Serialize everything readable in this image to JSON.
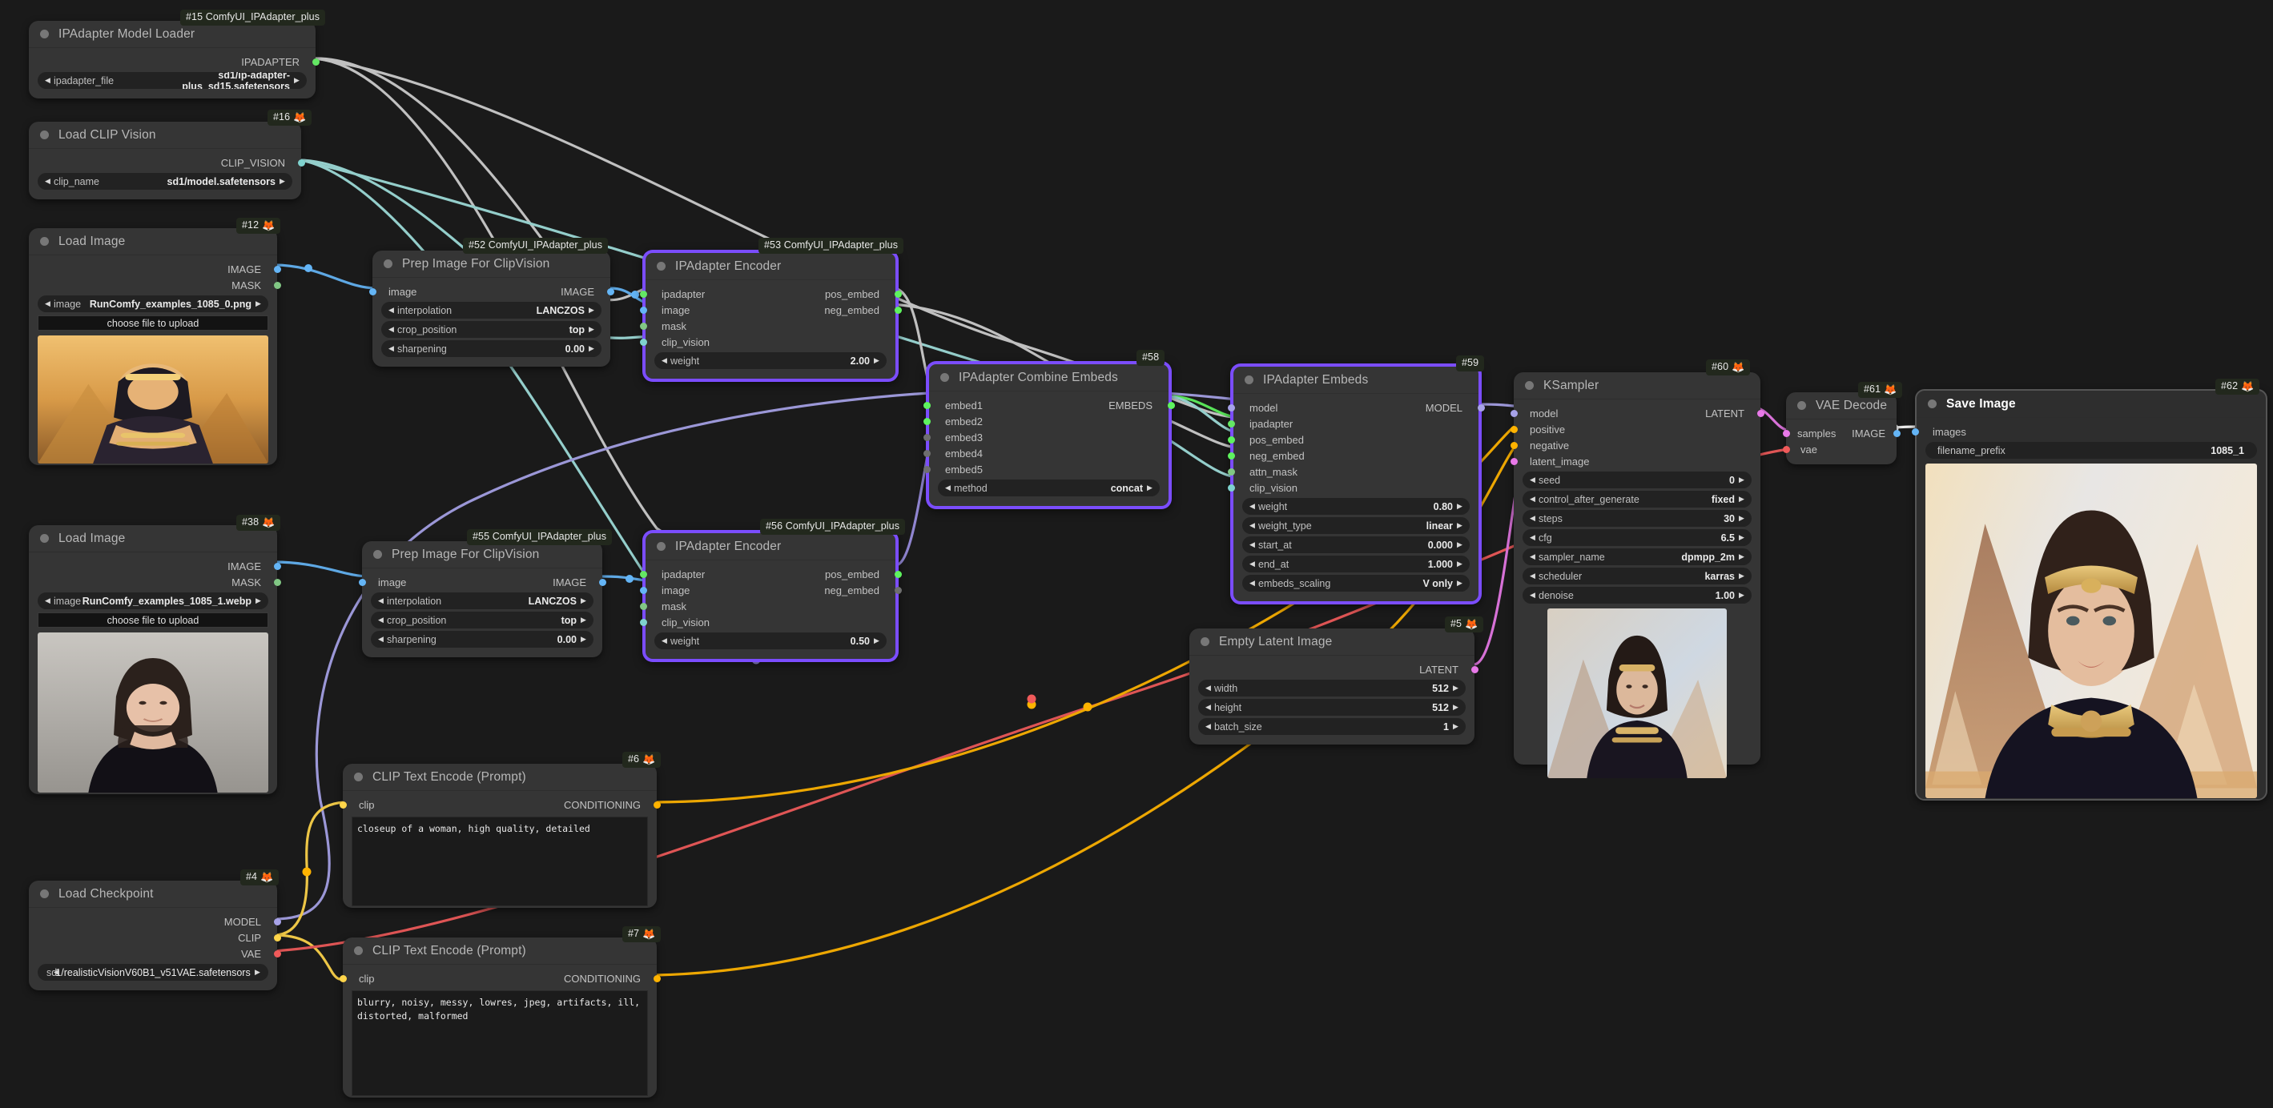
{
  "app": {
    "name": "ComfyUI",
    "canvas_background": "#1a1a1a"
  },
  "colors": {
    "selected_node_border": "#7b4dff",
    "node_body": "#353535",
    "badge_background": "#22281d",
    "image_link": "#64b5f6",
    "clipvision_link": "#7fd3cf",
    "ipadapter_link": "#64e764",
    "model_link": "#a7a2e8",
    "conditioning_link": "#ffb300",
    "vae_link": "#f05a5a",
    "latent_link": "#e879e8"
  },
  "nodes": {
    "ipadapter_model_loader": {
      "badge": "#15 ComfyUI_IPAdapter_plus",
      "badge_icon": "",
      "title": "IPAdapter Model Loader",
      "outputs": [
        {
          "label": "IPADAPTER",
          "type": "IPADAPTER"
        }
      ],
      "widgets": [
        {
          "label": "ipadapter_file",
          "value": "sd1/ip-adapter-plus_sd15.safetensors"
        }
      ]
    },
    "load_clip_vision": {
      "badge": "#16",
      "badge_icon": "🦊",
      "title": "Load CLIP Vision",
      "outputs": [
        {
          "label": "CLIP_VISION",
          "type": "CLIPVISION"
        }
      ],
      "widgets": [
        {
          "label": "clip_name",
          "value": "sd1/model.safetensors"
        }
      ]
    },
    "load_image_1": {
      "badge": "#12",
      "badge_icon": "🦊",
      "title": "Load Image",
      "outputs": [
        {
          "label": "IMAGE",
          "type": "IMAGE"
        },
        {
          "label": "MASK",
          "type": "MASK"
        }
      ],
      "widgets": [
        {
          "label": "image",
          "value": "RunComfy_examples_1085_0.png"
        }
      ],
      "upload_button": "choose file to upload"
    },
    "load_image_2": {
      "badge": "#38",
      "badge_icon": "🦊",
      "title": "Load Image",
      "outputs": [
        {
          "label": "IMAGE",
          "type": "IMAGE"
        },
        {
          "label": "MASK",
          "type": "MASK"
        }
      ],
      "widgets": [
        {
          "label": "image",
          "value": "RunComfy_examples_1085_1.webp"
        }
      ],
      "upload_button": "choose file to upload"
    },
    "prep_image_1": {
      "badge": "#52 ComfyUI_IPAdapter_plus",
      "badge_icon": "",
      "title": "Prep Image For ClipVision",
      "inputs": [
        {
          "label": "image",
          "type": "IMAGE"
        }
      ],
      "outputs": [
        {
          "label": "IMAGE",
          "type": "IMAGE"
        }
      ],
      "widgets": [
        {
          "label": "interpolation",
          "value": "LANCZOS"
        },
        {
          "label": "crop_position",
          "value": "top"
        },
        {
          "label": "sharpening",
          "value": "0.00"
        }
      ]
    },
    "prep_image_2": {
      "badge": "#55 ComfyUI_IPAdapter_plus",
      "badge_icon": "",
      "title": "Prep Image For ClipVision",
      "inputs": [
        {
          "label": "image",
          "type": "IMAGE"
        }
      ],
      "outputs": [
        {
          "label": "IMAGE",
          "type": "IMAGE"
        }
      ],
      "widgets": [
        {
          "label": "interpolation",
          "value": "LANCZOS"
        },
        {
          "label": "crop_position",
          "value": "top"
        },
        {
          "label": "sharpening",
          "value": "0.00"
        }
      ]
    },
    "ipadapter_encoder_1": {
      "badge": "#53 ComfyUI_IPAdapter_plus",
      "badge_icon": "",
      "title": "IPAdapter Encoder",
      "selected": true,
      "inputs": [
        {
          "label": "ipadapter",
          "type": "IPADAPTER"
        },
        {
          "label": "image",
          "type": "IMAGE"
        },
        {
          "label": "mask",
          "type": "MASK"
        },
        {
          "label": "clip_vision",
          "type": "CLIPVISION"
        }
      ],
      "outputs": [
        {
          "label": "pos_embed",
          "type": "EMBEDS"
        },
        {
          "label": "neg_embed",
          "type": "EMBEDS"
        }
      ],
      "widgets": [
        {
          "label": "weight",
          "value": "2.00"
        }
      ]
    },
    "ipadapter_encoder_2": {
      "badge": "#56 ComfyUI_IPAdapter_plus",
      "badge_icon": "",
      "title": "IPAdapter Encoder",
      "selected": true,
      "inputs": [
        {
          "label": "ipadapter",
          "type": "IPADAPTER"
        },
        {
          "label": "image",
          "type": "IMAGE"
        },
        {
          "label": "mask",
          "type": "MASK"
        },
        {
          "label": "clip_vision",
          "type": "CLIPVISION"
        }
      ],
      "outputs": [
        {
          "label": "pos_embed",
          "type": "EMBEDS"
        },
        {
          "label": "neg_embed",
          "type": "off"
        }
      ],
      "widgets": [
        {
          "label": "weight",
          "value": "0.50"
        }
      ]
    },
    "combine_embeds": {
      "badge": "#58",
      "badge_icon": "",
      "title": "IPAdapter Combine Embeds",
      "selected": true,
      "inputs": [
        {
          "label": "embed1",
          "type": "EMBEDS"
        },
        {
          "label": "embed2",
          "type": "EMBEDS"
        },
        {
          "label": "embed3",
          "type": "off"
        },
        {
          "label": "embed4",
          "type": "off"
        },
        {
          "label": "embed5",
          "type": "off"
        }
      ],
      "outputs": [
        {
          "label": "EMBEDS",
          "type": "EMBEDS"
        }
      ],
      "widgets": [
        {
          "label": "method",
          "value": "concat"
        }
      ]
    },
    "ipadapter_embeds": {
      "badge": "#59",
      "badge_icon": "",
      "title": "IPAdapter Embeds",
      "selected": true,
      "inputs": [
        {
          "label": "model",
          "type": "MODEL"
        },
        {
          "label": "ipadapter",
          "type": "IPADAPTER"
        },
        {
          "label": "pos_embed",
          "type": "EMBEDS"
        },
        {
          "label": "neg_embed",
          "type": "EMBEDS"
        },
        {
          "label": "attn_mask",
          "type": "MASK"
        },
        {
          "label": "clip_vision",
          "type": "CLIPVISION"
        }
      ],
      "outputs": [
        {
          "label": "MODEL",
          "type": "MODEL"
        }
      ],
      "widgets": [
        {
          "label": "weight",
          "value": "0.80"
        },
        {
          "label": "weight_type",
          "value": "linear"
        },
        {
          "label": "start_at",
          "value": "0.000"
        },
        {
          "label": "end_at",
          "value": "1.000"
        },
        {
          "label": "embeds_scaling",
          "value": "V only"
        }
      ]
    },
    "ksampler": {
      "badge": "#60",
      "badge_icon": "🦊",
      "title": "KSampler",
      "inputs": [
        {
          "label": "model",
          "type": "MODEL"
        },
        {
          "label": "positive",
          "type": "COND"
        },
        {
          "label": "negative",
          "type": "COND"
        },
        {
          "label": "latent_image",
          "type": "LATENT"
        }
      ],
      "outputs": [
        {
          "label": "LATENT",
          "type": "LATENT"
        }
      ],
      "widgets": [
        {
          "label": "seed",
          "value": "0"
        },
        {
          "label": "control_after_generate",
          "value": "fixed"
        },
        {
          "label": "steps",
          "value": "30"
        },
        {
          "label": "cfg",
          "value": "6.5"
        },
        {
          "label": "sampler_name",
          "value": "dpmpp_2m"
        },
        {
          "label": "scheduler",
          "value": "karras"
        },
        {
          "label": "denoise",
          "value": "1.00"
        }
      ]
    },
    "empty_latent_image": {
      "badge": "#5",
      "badge_icon": "🦊",
      "title": "Empty Latent Image",
      "outputs": [
        {
          "label": "LATENT",
          "type": "LATENT"
        }
      ],
      "widgets": [
        {
          "label": "width",
          "value": "512"
        },
        {
          "label": "height",
          "value": "512"
        },
        {
          "label": "batch_size",
          "value": "1"
        }
      ]
    },
    "clip_text_encode_positive": {
      "badge": "#6",
      "badge_icon": "🦊",
      "title": "CLIP Text Encode (Prompt)",
      "inputs": [
        {
          "label": "clip",
          "type": "CLIP"
        }
      ],
      "outputs": [
        {
          "label": "CONDITIONING",
          "type": "COND"
        }
      ],
      "text": "closeup of a woman, high quality, detailed"
    },
    "clip_text_encode_negative": {
      "badge": "#7",
      "badge_icon": "🦊",
      "title": "CLIP Text Encode (Prompt)",
      "inputs": [
        {
          "label": "clip",
          "type": "CLIP"
        }
      ],
      "outputs": [
        {
          "label": "CONDITIONING",
          "type": "COND"
        }
      ],
      "text": "blurry, noisy, messy, lowres, jpeg, artifacts, ill, distorted, malformed"
    },
    "load_checkpoint": {
      "badge": "#4",
      "badge_icon": "🦊",
      "title": "Load Checkpoint",
      "outputs": [
        {
          "label": "MODEL",
          "type": "MODEL"
        },
        {
          "label": "CLIP",
          "type": "CLIP"
        },
        {
          "label": "VAE",
          "type": "VAE"
        }
      ],
      "widgets": [
        {
          "label": "sd",
          "value": "1/realisticVisionV60B1_v51VAE.safetensors"
        }
      ]
    },
    "vae_decode": {
      "badge": "#61",
      "badge_icon": "🦊",
      "title": "VAE Decode",
      "inputs": [
        {
          "label": "samples",
          "type": "LATENT"
        },
        {
          "label": "vae",
          "type": "VAE"
        }
      ],
      "outputs": [
        {
          "label": "IMAGE",
          "type": "IMAGE"
        }
      ]
    },
    "save_image": {
      "badge": "#62",
      "badge_icon": "🦊",
      "title": "Save Image",
      "inputs": [
        {
          "label": "images",
          "type": "IMAGE"
        }
      ],
      "widgets": [
        {
          "label": "filename_prefix",
          "value": "1085_1"
        }
      ]
    }
  }
}
